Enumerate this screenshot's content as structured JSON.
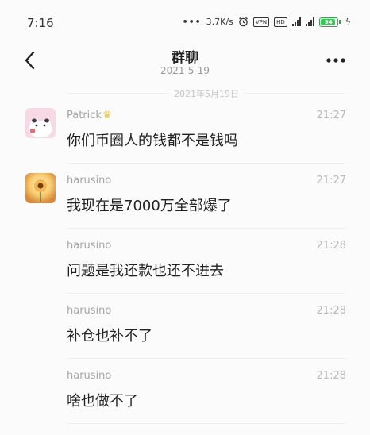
{
  "status_bar": {
    "time": "7:16",
    "net_speed": "3.7K/s",
    "vpn_badge": "VPN",
    "hd_badge": "HD",
    "battery_level": "94",
    "battery_fraction": 0.94
  },
  "header": {
    "title": "群聊",
    "subtitle": "2021-5-19"
  },
  "date_divider": "2021年5月19日",
  "messages": [
    {
      "name": "Patrick",
      "time": "21:27",
      "text": "你们币圈人的钱都不是钱吗"
    },
    {
      "name": "harusino",
      "time": "21:27",
      "text": "我现在是7000万全部爆了"
    },
    {
      "name": "harusino",
      "time": "21:28",
      "text": "问题是我还款也还不进去"
    },
    {
      "name": "harusino",
      "time": "21:28",
      "text": "补仓也补不了"
    },
    {
      "name": "harusino",
      "time": "21:28",
      "text": "啥也做不了"
    }
  ]
}
